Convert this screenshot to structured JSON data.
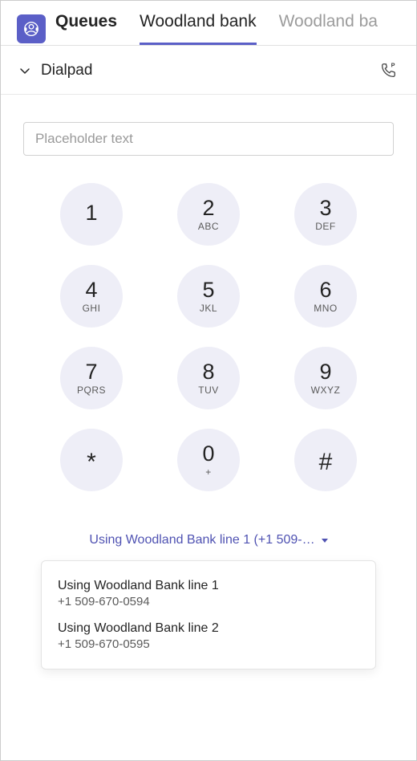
{
  "header": {
    "tabs": [
      {
        "label": "Queues",
        "bold": true,
        "active": false
      },
      {
        "label": "Woodland bank",
        "bold": false,
        "active": true
      },
      {
        "label": "Woodland ba",
        "bold": false,
        "active": false,
        "partial": true
      }
    ]
  },
  "section": {
    "title": "Dialpad"
  },
  "input": {
    "placeholder": "Placeholder text",
    "value": ""
  },
  "keypad": [
    {
      "digit": "1",
      "sub": ""
    },
    {
      "digit": "2",
      "sub": "ABC"
    },
    {
      "digit": "3",
      "sub": "DEF"
    },
    {
      "digit": "4",
      "sub": "GHI"
    },
    {
      "digit": "5",
      "sub": "JKL"
    },
    {
      "digit": "6",
      "sub": "MNO"
    },
    {
      "digit": "7",
      "sub": "PQRS"
    },
    {
      "digit": "8",
      "sub": "TUV"
    },
    {
      "digit": "9",
      "sub": "WXYZ"
    },
    {
      "digit": "*",
      "sub": ""
    },
    {
      "digit": "0",
      "sub": "+"
    },
    {
      "digit": "#",
      "sub": ""
    }
  ],
  "line": {
    "current": "Using Woodland Bank line 1 (+1 509-…",
    "options": [
      {
        "title": "Using Woodland Bank line 1",
        "number": "+1 509-670-0594"
      },
      {
        "title": "Using Woodland Bank line 2",
        "number": "+1 509-670-0595"
      }
    ]
  }
}
